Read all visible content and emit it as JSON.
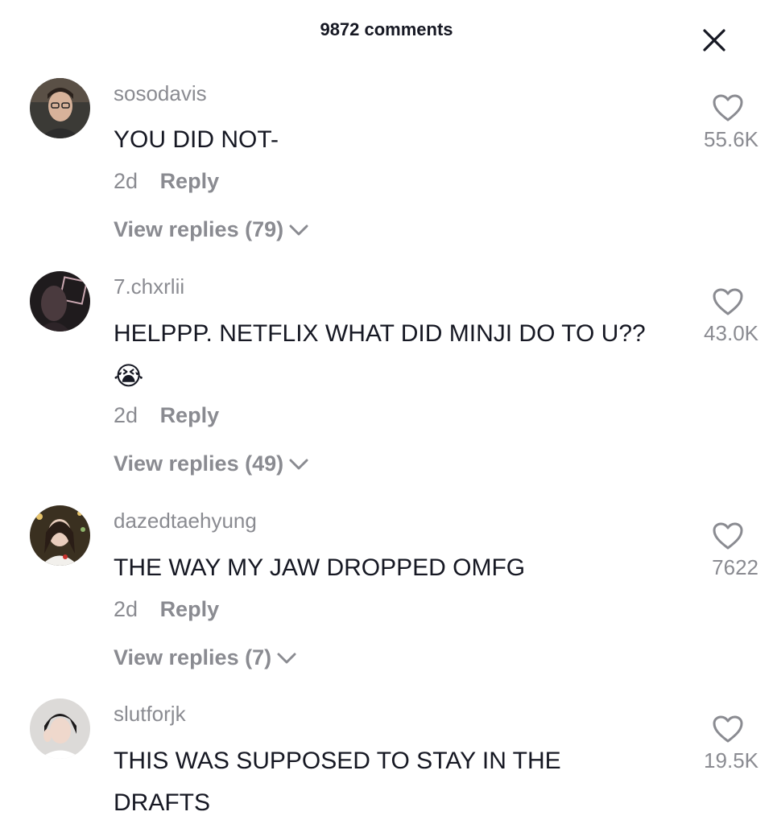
{
  "header": {
    "title": "9872 comments"
  },
  "comments": [
    {
      "username": "sosodavis",
      "text": "YOU DID NOT-",
      "emoji": "",
      "time": "2d",
      "reply_label": "Reply",
      "view_replies": "View replies (79)",
      "likes": "55.6K"
    },
    {
      "username": "7.chxrlii",
      "text": "HELPPP. NETFLIX WHAT DID MINJI DO TO U??",
      "emoji": "😭",
      "time": "2d",
      "reply_label": "Reply",
      "view_replies": "View replies (49)",
      "likes": "43.0K"
    },
    {
      "username": "dazedtaehyung",
      "text": "THE WAY MY JAW DROPPED OMFG",
      "emoji": "",
      "time": "2d",
      "reply_label": "Reply",
      "view_replies": "View replies (7)",
      "likes": "7622"
    },
    {
      "username": "slutforjk",
      "text": "THIS WAS SUPPOSED TO STAY IN THE DRAFTS",
      "emoji": "",
      "time": "",
      "reply_label": "",
      "view_replies": "",
      "likes": "19.5K"
    }
  ],
  "colors": {
    "primary_text": "#161823",
    "secondary_text": "#8a8b91",
    "background": "#ffffff"
  },
  "icons": {
    "close": "close-icon",
    "like": "heart-outline-icon",
    "expand": "chevron-down-icon"
  }
}
